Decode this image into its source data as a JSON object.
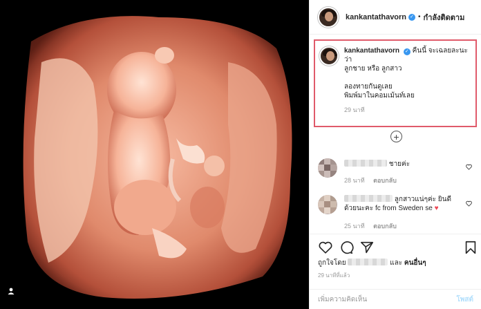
{
  "header": {
    "username": "kankantathavorn",
    "dot": "•",
    "follow_label": "กำลังติดตาม"
  },
  "caption": {
    "username": "kankantathavorn",
    "lines": [
      "คืนนี้ จะเฉลยละนะ",
      "ว่า",
      "ลูกชาย หรือ ลูกสาว",
      "",
      "ลองทายกันดูเลย",
      "พิมพ์มาในคอมเม้นท์เลย"
    ],
    "time": "29 นาที"
  },
  "comments": [
    {
      "text": "ชายค่ะ",
      "time": "28 นาที",
      "reply": "ตอบกลับ"
    },
    {
      "text": "ลูกสาวแน่ๆค่ะ ยินดีด้วยนะคะ fc from Sweden se",
      "time": "25 นาที",
      "reply": "ตอบกลับ"
    }
  ],
  "likes": {
    "prefix": "ถูกใจโดย",
    "and": "และ",
    "others": "คนอื่นๆ"
  },
  "post_time": "29 นาทีที่แล้ว",
  "add_comment": {
    "placeholder": "เพิ่มความคิดเห็น",
    "post_label": "โพสต์"
  },
  "icons": {
    "verified": "verified-badge-icon",
    "tag": "user-tag-icon",
    "add": "plus-circle-icon",
    "like": "heart-icon",
    "comment": "comment-bubble-icon",
    "share": "paper-plane-icon",
    "save": "bookmark-icon"
  },
  "colors": {
    "highlight_border": "#e05a6a",
    "verified": "#3897f0",
    "heart_red": "#ed4956",
    "post_button": "#b2dffc"
  }
}
